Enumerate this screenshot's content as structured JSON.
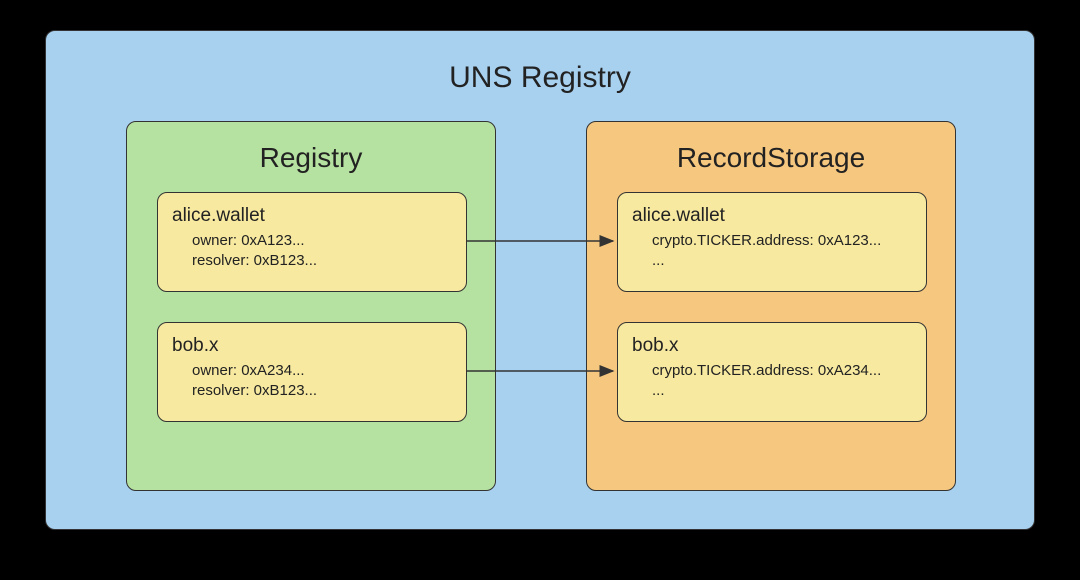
{
  "outer": {
    "title": "UNS Registry"
  },
  "registry": {
    "title": "Registry",
    "cards": [
      {
        "name": "alice.wallet",
        "line1": "owner: 0xA123...",
        "line2": "resolver: 0xB123..."
      },
      {
        "name": "bob.x",
        "line1": "owner: 0xA234...",
        "line2": "resolver: 0xB123..."
      }
    ]
  },
  "storage": {
    "title": "RecordStorage",
    "cards": [
      {
        "name": "alice.wallet",
        "line1": "crypto.TICKER.address: 0xA123...",
        "line2": "..."
      },
      {
        "name": "bob.x",
        "line1": "crypto.TICKER.address: 0xA234...",
        "line2": "..."
      }
    ]
  }
}
